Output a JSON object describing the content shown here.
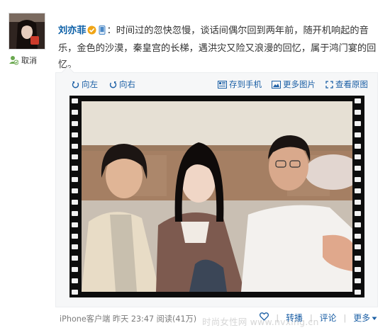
{
  "post": {
    "author": "刘亦菲",
    "text": "：时间过的忽快忽慢，谈话间偶尔回到两年前，随开机响起的音乐，金色的沙漠，秦皇宫的长梯，遇洪灾又险又浪漫的回忆，属于鸿门宴的回忆。"
  },
  "sidebar": {
    "unfollow_label": "取消"
  },
  "media_toolbar": {
    "rotate_left": "向左",
    "rotate_right": "向右",
    "save_to_phone": "存到手机",
    "more_pictures": "更多图片",
    "view_original": "查看原图"
  },
  "footer": {
    "source": "iPhone客户端",
    "time": "昨天 23:47",
    "reads": "阅读(41万)"
  },
  "actions": {
    "repost": "转播",
    "comment": "评论",
    "more": "更多"
  },
  "watermark": "时尚女性网 www.nvxing.cn",
  "colors": {
    "link": "#1b5fa5",
    "author": "#0a5ea6",
    "badge": "#f0a516"
  },
  "icons": [
    "unfollow-icon",
    "vip-badge-icon",
    "rotate-left-icon",
    "rotate-right-icon",
    "phone-icon",
    "pictures-icon",
    "expand-icon",
    "heart-icon",
    "chevron-down-icon"
  ]
}
